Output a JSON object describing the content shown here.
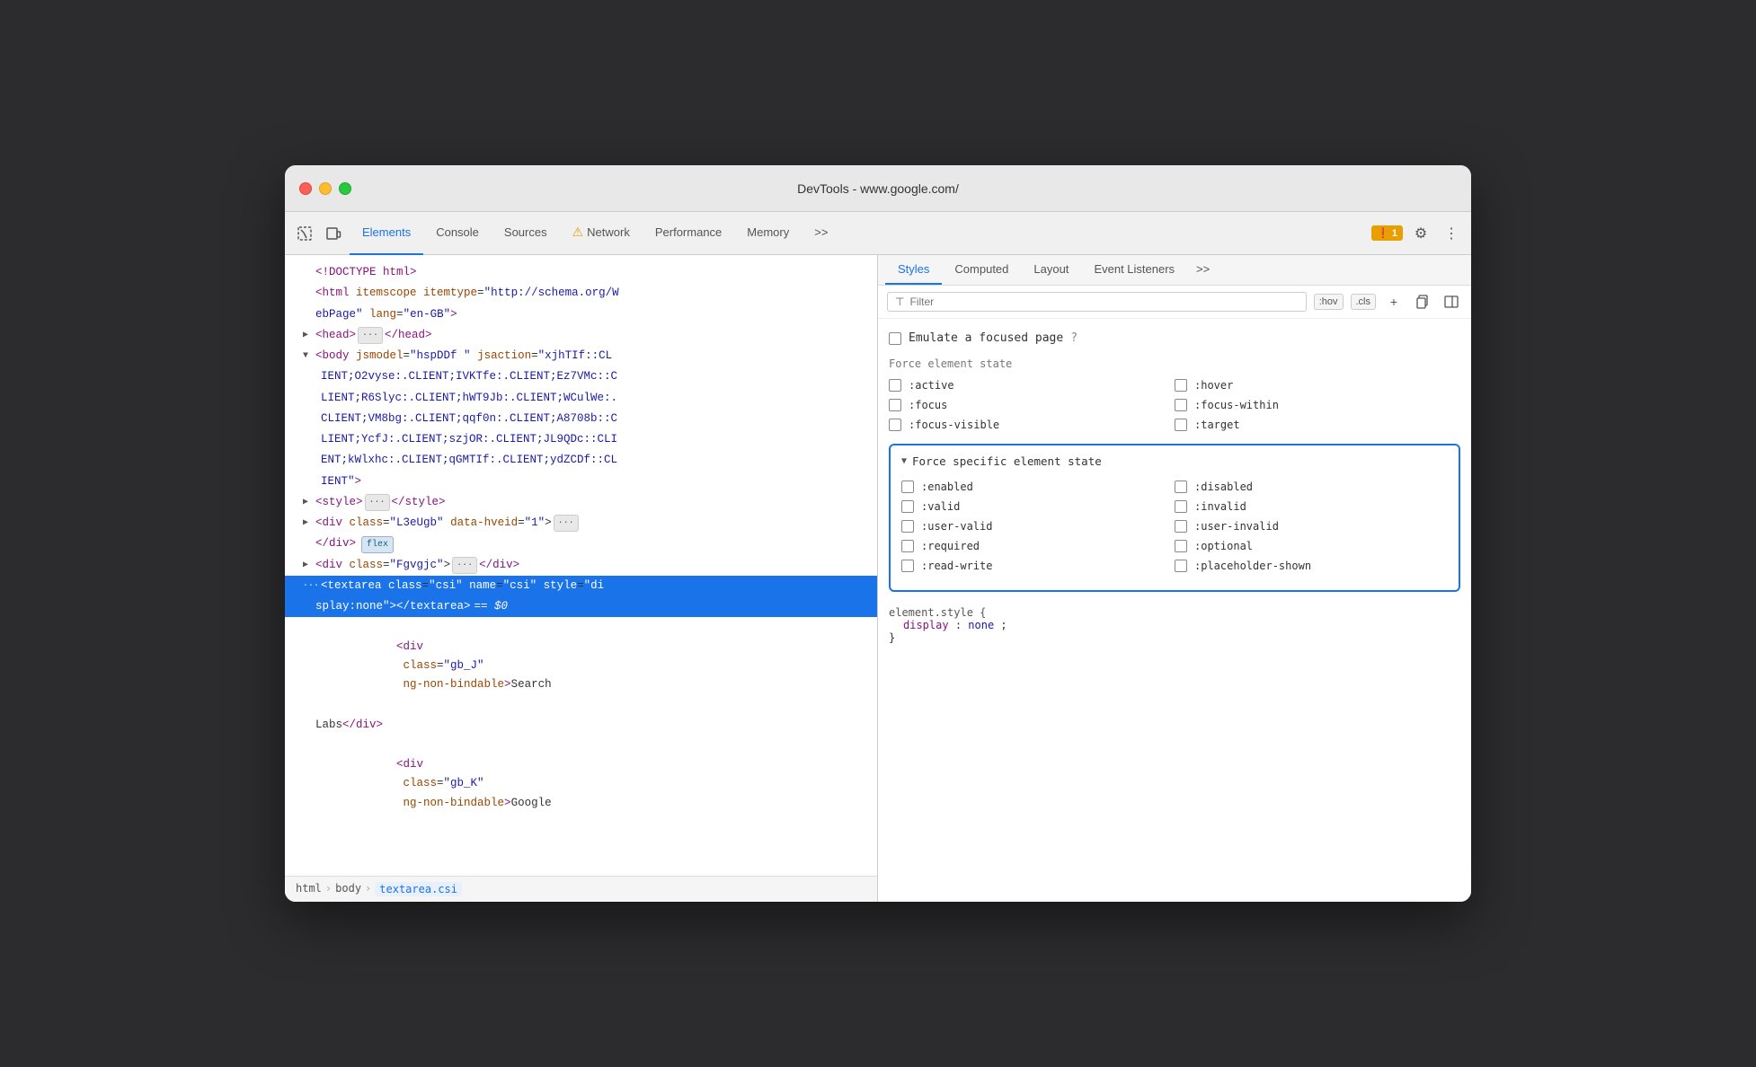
{
  "window": {
    "title": "DevTools - www.google.com/",
    "traffic_lights": [
      "close",
      "minimize",
      "maximize"
    ]
  },
  "toolbar": {
    "tabs": [
      {
        "id": "elements",
        "label": "Elements",
        "active": true
      },
      {
        "id": "console",
        "label": "Console",
        "active": false
      },
      {
        "id": "sources",
        "label": "Sources",
        "active": false
      },
      {
        "id": "network",
        "label": "Network",
        "active": false,
        "has_warning": true
      },
      {
        "id": "performance",
        "label": "Performance",
        "active": false
      },
      {
        "id": "memory",
        "label": "Memory",
        "active": false
      }
    ],
    "more_tabs": ">>",
    "error_badge": "1",
    "settings_label": "⚙",
    "more_options": "⋮"
  },
  "dom_panel": {
    "lines": [
      {
        "indent": 0,
        "content": "<!DOCTYPE html>",
        "type": "doctype"
      },
      {
        "indent": 0,
        "content": "<html itemscope itemtype=\"http://schema.org/W",
        "type": "tag"
      },
      {
        "indent": 0,
        "content": "ebPage\" lang=\"en-GB\">",
        "type": "continuation"
      },
      {
        "indent": 1,
        "content": "<head>···</head>",
        "type": "tag",
        "has_triangle": true
      },
      {
        "indent": 1,
        "content": "<body jsmodel=\"hspDDf \" jsaction=\"xjhTIf::CL",
        "type": "tag",
        "expanded": true
      },
      {
        "indent": 1,
        "content": "IENT;O2vyse:.CLIENT;IVKTfe:.CLIENT;Ez7VMc::C",
        "type": "continuation"
      },
      {
        "indent": 1,
        "content": "LIENT;R6Slyc:.CLIENT;hWT9Jb:.CLIENT;WCulWe:",
        "type": "continuation"
      },
      {
        "indent": 1,
        "content": "CLIENT;VM8bg:.CLIENT;qqf0n:.CLIENT;A8708b::C",
        "type": "continuation"
      },
      {
        "indent": 1,
        "content": "LIENT;YcfJ:.CLIENT;szjOR:.CLIENT;JL9QDc::CLI",
        "type": "continuation"
      },
      {
        "indent": 1,
        "content": "ENT;kWlxhc:.CLIENT;qGMTIf:.CLIENT;ydZCDf::CL",
        "type": "continuation"
      },
      {
        "indent": 1,
        "content": "IENT\">",
        "type": "continuation"
      },
      {
        "indent": 2,
        "content": "<style>···</style>",
        "type": "tag",
        "has_triangle": true
      },
      {
        "indent": 2,
        "content": "<div class=\"L3eUgb\" data-hveid=\"1\">···",
        "type": "tag",
        "has_triangle": true
      },
      {
        "indent": 2,
        "content": "</div> flex",
        "type": "tag",
        "has_flex": true
      },
      {
        "indent": 2,
        "content": "<div class=\"Fgvgjc\">···</div>",
        "type": "tag",
        "has_triangle": true
      },
      {
        "indent": 2,
        "content": "<textarea class=\"csi\" name=\"csi\" style=\"di",
        "type": "tag",
        "selected": true
      },
      {
        "indent": 2,
        "content": "splay:none\"></textarea> == $0",
        "type": "continuation",
        "selected": true
      },
      {
        "indent": 2,
        "content": "<div class=\"gb_J\" ng-non-bindable>Search",
        "type": "tag"
      },
      {
        "indent": 2,
        "content": "Labs</div>",
        "type": "continuation"
      },
      {
        "indent": 2,
        "content": "<div class=\"gb_K\" ng-non-bindable>Google",
        "type": "continuation"
      }
    ],
    "breadcrumbs": [
      "html",
      "body",
      "textarea.csi"
    ]
  },
  "styles_panel": {
    "tabs": [
      {
        "id": "styles",
        "label": "Styles",
        "active": true
      },
      {
        "id": "computed",
        "label": "Computed",
        "active": false
      },
      {
        "id": "layout",
        "label": "Layout",
        "active": false
      },
      {
        "id": "event_listeners",
        "label": "Event Listeners",
        "active": false
      }
    ],
    "filter_placeholder": "Filter",
    "hov_label": ":hov",
    "cls_label": ".cls",
    "emulate_focused": "Emulate a focused page",
    "force_element_state_label": "Force element state",
    "force_states": [
      {
        "id": "active",
        "label": ":active"
      },
      {
        "id": "hover",
        "label": ":hover"
      },
      {
        "id": "focus",
        "label": ":focus"
      },
      {
        "id": "focus-within",
        "label": ":focus-within"
      },
      {
        "id": "focus-visible",
        "label": ":focus-visible"
      },
      {
        "id": "target",
        "label": ":target"
      }
    ],
    "force_specific_label": "Force specific element state",
    "force_specific_states": [
      {
        "id": "enabled",
        "label": ":enabled"
      },
      {
        "id": "disabled",
        "label": ":disabled"
      },
      {
        "id": "valid",
        "label": ":valid"
      },
      {
        "id": "invalid",
        "label": ":invalid"
      },
      {
        "id": "user-valid",
        "label": ":user-valid"
      },
      {
        "id": "user-invalid",
        "label": ":user-invalid"
      },
      {
        "id": "required",
        "label": ":required"
      },
      {
        "id": "optional",
        "label": ":optional"
      },
      {
        "id": "read-write",
        "label": ":read-write"
      },
      {
        "id": "placeholder-shown",
        "label": ":placeholder-shown"
      }
    ],
    "element_style": {
      "selector": "element.style {",
      "property": "display",
      "value": "none",
      "close": "}"
    }
  }
}
